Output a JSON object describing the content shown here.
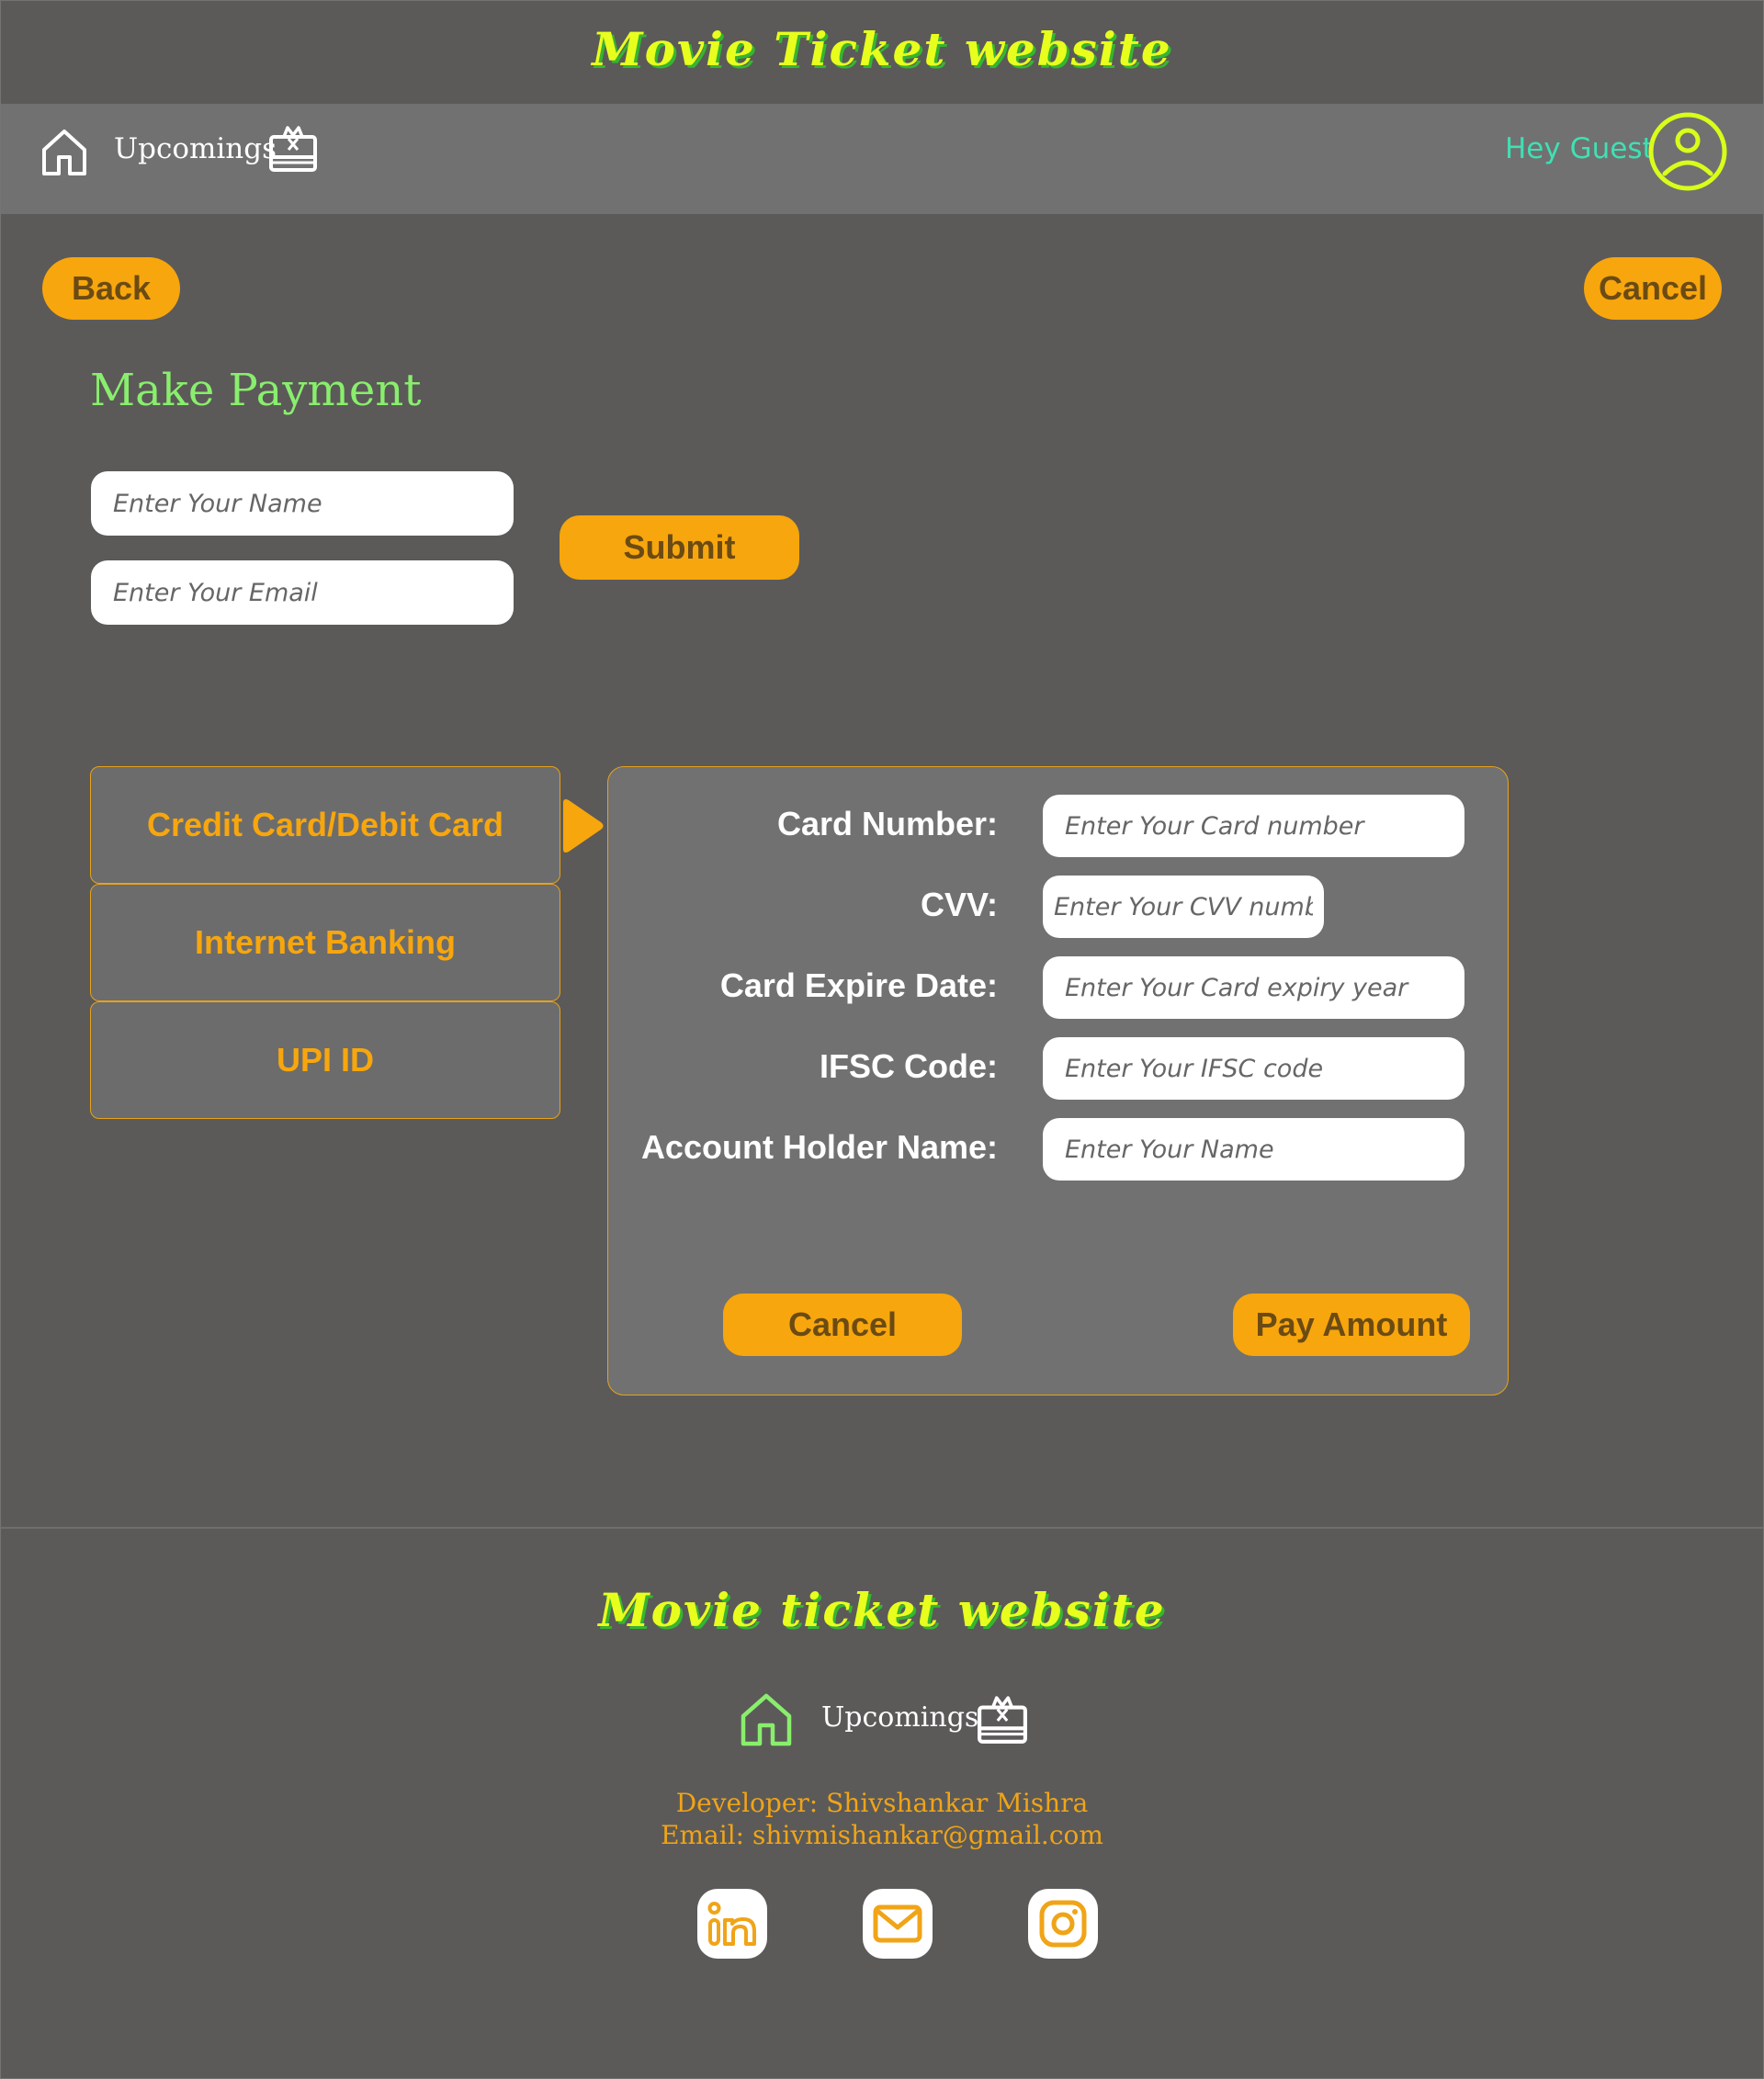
{
  "header": {
    "site_title": "Movie Ticket website",
    "nav": {
      "home_icon": "home-icon",
      "upcoming_label": "Upcomings",
      "gift_icon": "gift-icon"
    },
    "greeting": "Hey Guest",
    "avatar_icon": "user-circle-icon"
  },
  "actions": {
    "back_label": "Back",
    "cancel_label": "Cancel"
  },
  "contact_form": {
    "title": "Make Payment",
    "name_placeholder": "Enter Your Name",
    "email_placeholder": "Enter Your Email",
    "submit_label": "Submit"
  },
  "payment_methods": [
    {
      "label": "Credit Card/Debit Card",
      "selected": true
    },
    {
      "label": "Internet Banking",
      "selected": false
    },
    {
      "label": "UPI ID",
      "selected": false
    }
  ],
  "card_form": {
    "fields": [
      {
        "label": "Card Number:",
        "placeholder": "Enter Your Card number"
      },
      {
        "label": "CVV:",
        "placeholder": "Enter Your CVV number"
      },
      {
        "label": "Card Expire Date:",
        "placeholder": "Enter Your Card expiry year"
      },
      {
        "label": "IFSC Code:",
        "placeholder": "Enter Your IFSC code"
      },
      {
        "label": "Account Holder Name:",
        "placeholder": "Enter Your Name"
      }
    ],
    "cancel_label": "Cancel",
    "pay_label": "Pay Amount"
  },
  "footer": {
    "site_title": "Movie ticket website",
    "upcoming_label": "Upcomings",
    "developer": "Developer: Shivshankar Mishra",
    "email": "Email: shivmishankar@gmail.com",
    "social_icons": [
      "linkedin-icon",
      "mail-icon",
      "instagram-icon"
    ]
  },
  "colors": {
    "background": "#5b5a58",
    "navbar": "#717171",
    "accent": "#f7a60d",
    "title_yellow": "#e8ff1e",
    "title_shadow": "#35b62f",
    "heading_green": "#89ee6d",
    "greeting": "#3fe0b2"
  }
}
